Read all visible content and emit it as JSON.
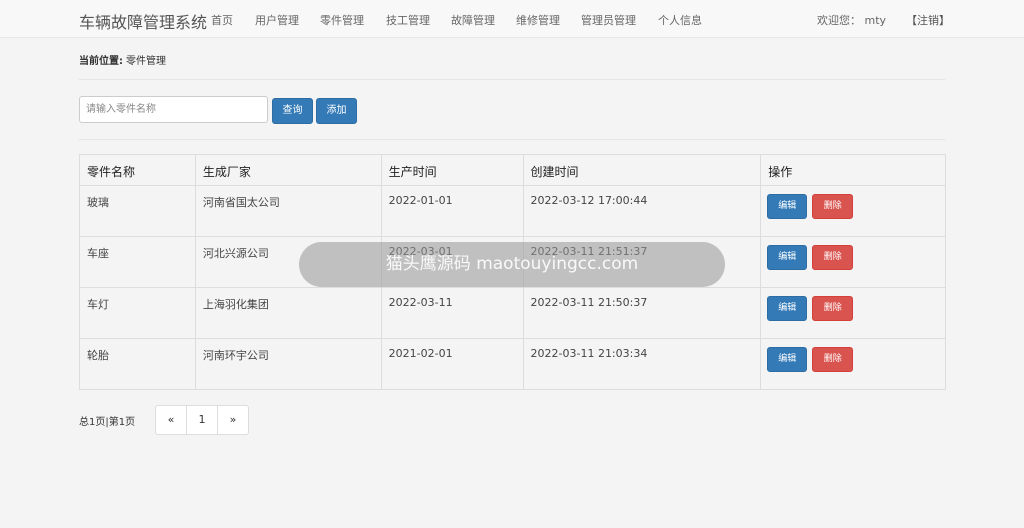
{
  "app": {
    "title": "车辆故障管理系统"
  },
  "nav": {
    "items": [
      "首页",
      "用户管理",
      "零件管理",
      "技工管理",
      "故障管理",
      "维修管理",
      "管理员管理",
      "个人信息"
    ],
    "welcome": "欢迎您： mty",
    "logout": "【注销】"
  },
  "breadcrumb": {
    "label": "当前位置:",
    "current": "零件管理"
  },
  "search": {
    "placeholder": "请输入零件名称",
    "value": "",
    "query_label": "查询",
    "add_label": "添加"
  },
  "table": {
    "headers": [
      "零件名称",
      "生成厂家",
      "生产时间",
      "创建时间",
      "操作"
    ],
    "rows": [
      [
        "玻璃",
        "河南省国太公司",
        "2022-01-01",
        "2022-03-12 17:00:44"
      ],
      [
        "车座",
        "河北兴源公司",
        "2022-03-01",
        "2022-03-11 21:51:37"
      ],
      [
        "车灯",
        "上海羽化集团",
        "2022-03-11",
        "2022-03-11 21:50:37"
      ],
      [
        "轮胎",
        "河南环宇公司",
        "2021-02-01",
        "2022-03-11 21:03:34"
      ]
    ],
    "edit_label": "编辑",
    "delete_label": "删除"
  },
  "pagination": {
    "info": "总1页|第1页",
    "prev": "«",
    "current": "1",
    "next": "»"
  },
  "overlay": {
    "text": "猫头鹰源码 maotouyingcc.com"
  },
  "colors": {
    "primary": "#337ab7",
    "danger": "#d9534f"
  }
}
